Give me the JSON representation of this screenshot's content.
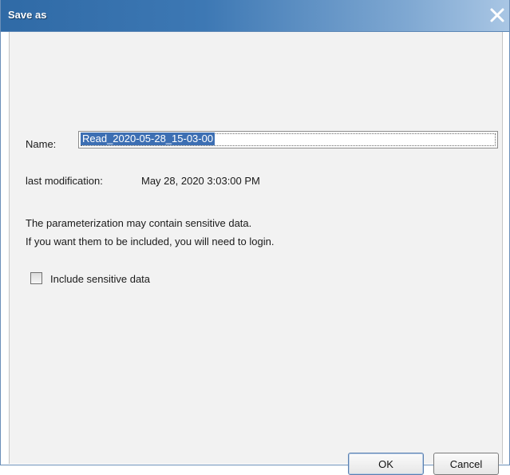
{
  "dialog": {
    "title": "Save as",
    "close_icon": "close-icon"
  },
  "form": {
    "name_label": "Name:",
    "name_value": "Read_2020-05-28_15-03-00",
    "last_modification_label": "last modification:",
    "last_modification_value": "May 28, 2020 3:03:00 PM",
    "warning_line1": "The parameterization may contain sensitive data.",
    "warning_line2": "If you want them to be included, you will need to login.",
    "include_sensitive_label": "Include sensitive data",
    "include_sensitive_checked": false
  },
  "buttons": {
    "ok_label": "OK",
    "cancel_label": "Cancel"
  },
  "colors": {
    "title_bar": "#3d78b4",
    "selection": "#3d6fb3",
    "content_bg": "#f2f2f2"
  }
}
